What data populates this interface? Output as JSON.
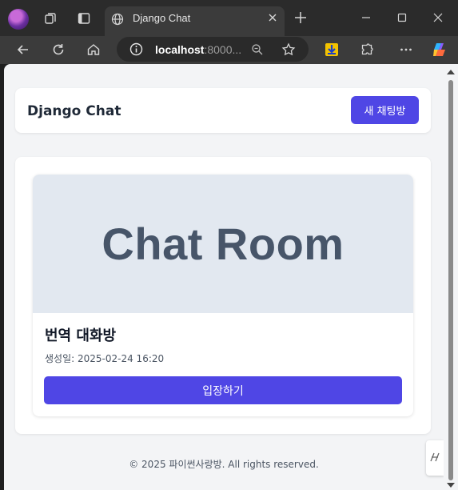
{
  "browser": {
    "tab_title": "Django Chat",
    "address_host": "localhost",
    "address_rest": ":8000..."
  },
  "page": {
    "brand": "Django Chat",
    "new_room_button": "새 채팅방",
    "rooms": [
      {
        "image_text": "Chat Room",
        "name": "번역 대화방",
        "created_label": "생성일:",
        "created_at": "2025-02-24 16:20",
        "enter_button": "입장하기"
      }
    ],
    "footer": "© 2025 파이썬사랑방. All rights reserved."
  },
  "colors": {
    "accent": "#4f46e5",
    "page_bg": "#f3f4f6",
    "image_bg": "#e2e8f0",
    "image_text": "#475569"
  },
  "icons": [
    "profile-avatar",
    "collections-icon",
    "tab-actions-icon",
    "globe-icon",
    "close-icon",
    "plus-icon",
    "minimize-icon",
    "maximize-icon",
    "window-close-icon",
    "back-icon",
    "refresh-icon",
    "home-icon",
    "info-icon",
    "zoom-icon",
    "star-icon",
    "download-extension-icon",
    "extensions-icon",
    "more-icon",
    "copilot-icon",
    "side-panel-icon"
  ]
}
